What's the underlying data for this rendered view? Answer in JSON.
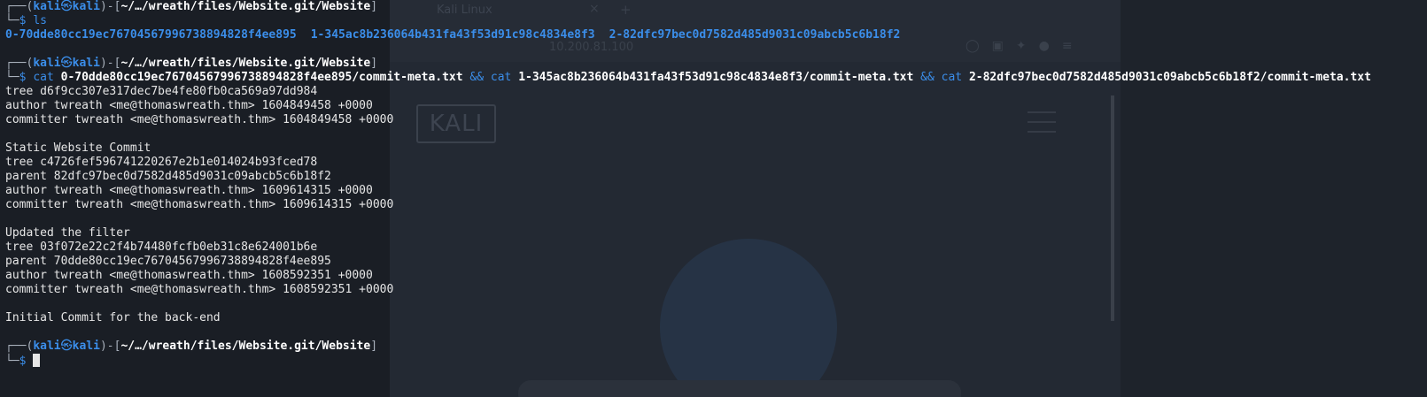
{
  "background": {
    "browser_tab_title": "Kali Linux",
    "browser_url_fragment": "10.200.81.100",
    "kali_logo_text": "KALI"
  },
  "prompt": {
    "corner_top": "┌──(",
    "user": "kali",
    "at_symbol": "㉿",
    "host": "kali",
    "mid": ")-[",
    "path": "~/…/wreath/files/Website.git/Website",
    "close": "]",
    "corner_bottom": "└─",
    "dollar": "$"
  },
  "commands": {
    "ls": "ls",
    "cat_cmd": "cat",
    "and_op": "&&",
    "cat_args": [
      "0-70dde80cc19ec76704567996738894828f4ee895/commit-meta.txt",
      "1-345ac8b236064b431fa43f53d91c98c4834e8f3/commit-meta.txt",
      "2-82dfc97bec0d7582d485d9031c09abcb5c6b18f2/commit-meta.txt"
    ]
  },
  "ls_output": [
    "0-70dde80cc19ec76704567996738894828f4ee895",
    "1-345ac8b236064b431fa43f53d91c98c4834e8f3",
    "2-82dfc97bec0d7582d485d9031c09abcb5c6b18f2"
  ],
  "cat_output": [
    "tree d6f9cc307e317dec7be4fe80fb0ca569a97dd984",
    "author twreath <me@thomaswreath.thm> 1604849458 +0000",
    "committer twreath <me@thomaswreath.thm> 1604849458 +0000",
    "",
    "Static Website Commit",
    "tree c4726fef596741220267e2b1e014024b93fced78",
    "parent 82dfc97bec0d7582d485d9031c09abcb5c6b18f2",
    "author twreath <me@thomaswreath.thm> 1609614315 +0000",
    "committer twreath <me@thomaswreath.thm> 1609614315 +0000",
    "",
    "Updated the filter",
    "tree 03f072e22c2f4b74480fcfb0eb31c8e624001b6e",
    "parent 70dde80cc19ec76704567996738894828f4ee895",
    "author twreath <me@thomaswreath.thm> 1608592351 +0000",
    "committer twreath <me@thomaswreath.thm> 1608592351 +0000",
    "",
    "Initial Commit for the back-end"
  ],
  "colors": {
    "accent_blue": "#3b8eea",
    "text": "#e6e6e6",
    "background": "#1c2129"
  }
}
